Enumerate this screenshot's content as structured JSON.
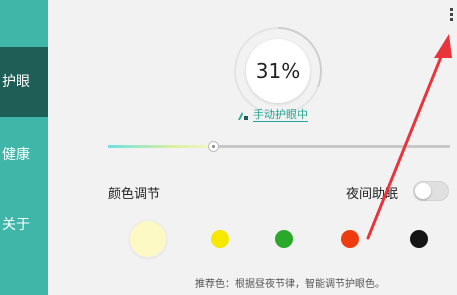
{
  "sidebar": {
    "items": [
      {
        "label": "护眼",
        "active": true
      },
      {
        "label": "健康",
        "active": false
      },
      {
        "label": "关于",
        "active": false
      }
    ]
  },
  "header": {
    "menu_icon": "more-vertical-icon"
  },
  "eye_care": {
    "percent_label": "31%",
    "percent_value": 0.31,
    "mode_label": "手动护眼中",
    "mode_icon": "manual-mode-icon"
  },
  "slider": {
    "value": 0.31
  },
  "color": {
    "title": "颜色调节",
    "swatches": [
      "#fdf9c4",
      "#f7e800",
      "#29a829",
      "#ee3c0e",
      "#151515"
    ],
    "selected_index": 0
  },
  "night_mode": {
    "label": "夜间助眠",
    "enabled": false
  },
  "recommendation": "推荐色：根据昼夜节律，智能调节护眼色。",
  "colors": {
    "sidebar": "#3fb6a8",
    "sidebar_active": "#1f5e56",
    "accent": "#2aa596",
    "annotation_arrow": "#e8343a"
  }
}
